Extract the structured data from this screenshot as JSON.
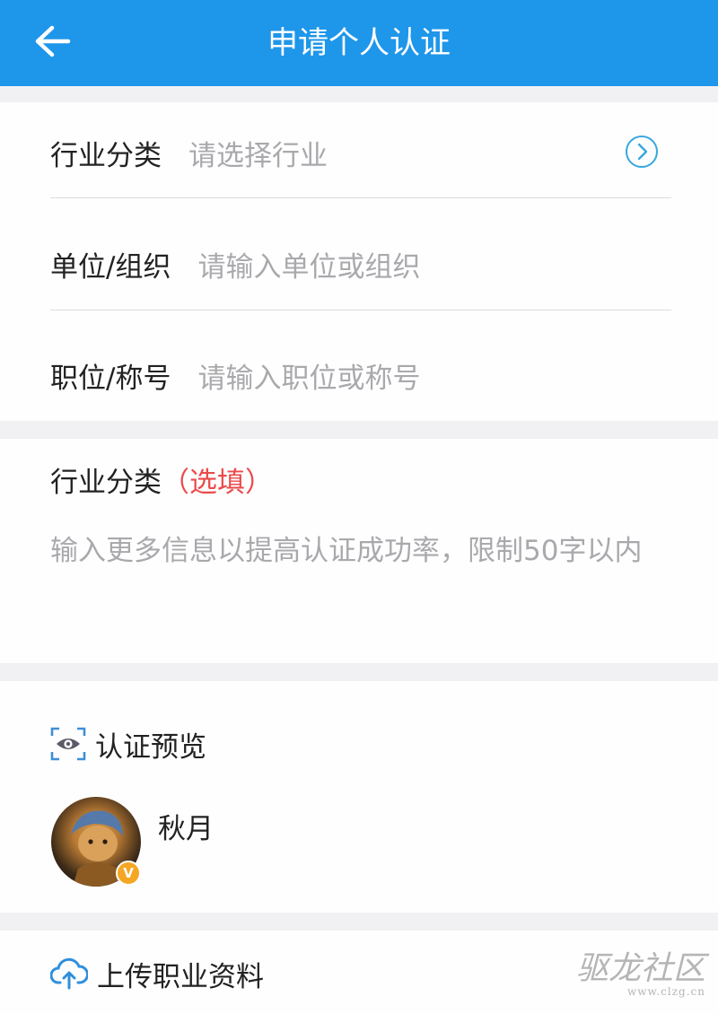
{
  "header": {
    "title": "申请个人认证",
    "back_icon": "arrow-left-icon"
  },
  "form": {
    "industry": {
      "label": "行业分类",
      "placeholder": "请选择行业",
      "icon": "chevron-right-circle-icon"
    },
    "organization": {
      "label": "单位/组织",
      "placeholder": "请输入单位或组织"
    },
    "position": {
      "label": "职位/称号",
      "placeholder": "请输入职位或称号"
    }
  },
  "optional_section": {
    "title": "行业分类",
    "optional_tag": "（选填）",
    "description": "输入更多信息以提高认证成功率，限制50字以内"
  },
  "preview": {
    "title": "认证预览",
    "icon": "eye-scan-icon",
    "username": "秋月",
    "badge": "V",
    "badge_color": "#f5a623"
  },
  "upload": {
    "label": "上传职业资料",
    "icon": "cloud-upload-icon"
  },
  "watermark": {
    "text": "驱龙社区",
    "url": "www.clzg.cn"
  },
  "colors": {
    "primary": "#1e96ea",
    "accent_red": "#ea4b4b"
  }
}
